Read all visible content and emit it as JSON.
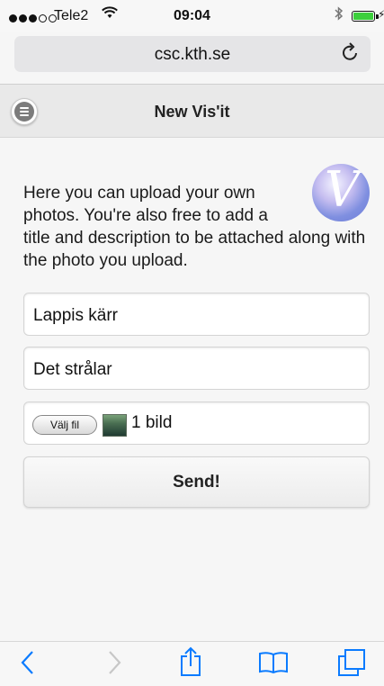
{
  "status": {
    "carrier": "Tele2",
    "time": "09:04",
    "wifi_icon": "wifi-icon",
    "bluetooth_icon": "bluetooth-icon",
    "battery_level": 0.95
  },
  "browser": {
    "url": "csc.kth.se",
    "reload_icon": "reload-icon"
  },
  "header": {
    "title": "New Vis'it",
    "menu_icon": "menu-icon"
  },
  "main": {
    "intro_line1": "Here you can upload your own",
    "intro_line2": "photos. You're also free to add a",
    "intro_rest": "title and description to be attached along with the photo you upload.",
    "logo_letter": "V"
  },
  "form": {
    "title_value": "Lappis kärr",
    "description_value": "Det strålar",
    "file_button_label": "Välj fil",
    "file_count": "1 bild",
    "send_label": "Send!"
  },
  "toolbar": {
    "back_icon": "back-icon",
    "forward_icon": "forward-icon",
    "share_icon": "share-icon",
    "bookmarks_icon": "bookmarks-icon",
    "tabs_icon": "tabs-icon"
  },
  "colors": {
    "accent": "#0a7bff",
    "header_bg": "#e9e9e9",
    "page_bg": "#f6f6f6"
  }
}
